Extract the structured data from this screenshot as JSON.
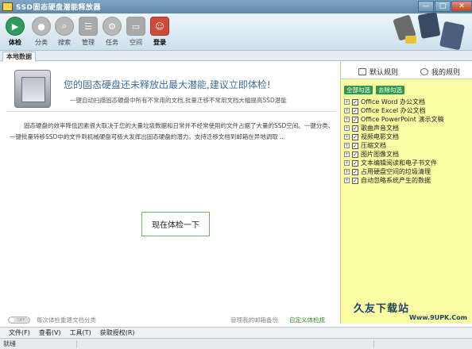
{
  "window": {
    "title": "SSD固态硬盘潜能释放器",
    "buttons": [
      "—",
      "□",
      "✕"
    ]
  },
  "toolbar": {
    "items": [
      {
        "label": "体检",
        "icon": "play-icon"
      },
      {
        "label": "分类",
        "icon": "location-pin-icon"
      },
      {
        "label": "搜索",
        "icon": "search-icon"
      },
      {
        "label": "管理",
        "icon": "list-icon"
      },
      {
        "label": "任务",
        "icon": "gear-icon"
      },
      {
        "label": "空间",
        "icon": "disk-icon"
      },
      {
        "label": "登录",
        "icon": "user-icon"
      }
    ]
  },
  "tabs": {
    "local": "本地数据"
  },
  "main": {
    "hero_title": "您的固态硬盘还未释放出最大潜能,建议立即体检!",
    "hero_sub": "一键自动扫描固态硬盘中所有不常用的文档,批量迁移不常用文档大幅提高SSD潜能",
    "description": "固态硬盘的效率降低因素很大取决于您的大量垃圾数据和日常并不经常使用的文件占据了大量的SSD空间。一键分类、一键批量转移SSD中的文件到机械硬盘可极大发挥出固态硬盘的潜力。支持迁移文档到邮箱在异地调取 ..",
    "check_button": "现在体检一下",
    "toggle_text": "OFF",
    "toggle_label": "每次体检重建文档分类",
    "link_mailbox": "管理我的邮箱备份",
    "link_custom": "自定义体检规"
  },
  "side": {
    "tab_default": "默认规则",
    "tab_mine": "我的规则",
    "select_all": "全部勾选",
    "deselect_all": "去除勾选",
    "rules": [
      "Office Word 办公文档",
      "Office Excel 办公文档",
      "Office PowerPoint 演示文稿",
      "歌曲声音文档",
      "视频电影文档",
      "压缩文档",
      "图片图像文档",
      "文本编辑阅读和电子书文件",
      "占用硬盘空间的垃圾清理",
      "自动忽略系统产生的数据"
    ],
    "watermark": "久友下载站",
    "watermark_sub": "Www.9UPK.Com"
  },
  "menubar": {
    "items": [
      "文件(F)",
      "查看(V)",
      "工具(T)",
      "获取授权(R)"
    ]
  },
  "status": {
    "text": "就绪"
  },
  "colors": {
    "accent_green": "#2f9a5d",
    "side_yellow": "#fafca3",
    "title_blue": "#3f6fa0",
    "login_red": "#cf4a3b"
  }
}
